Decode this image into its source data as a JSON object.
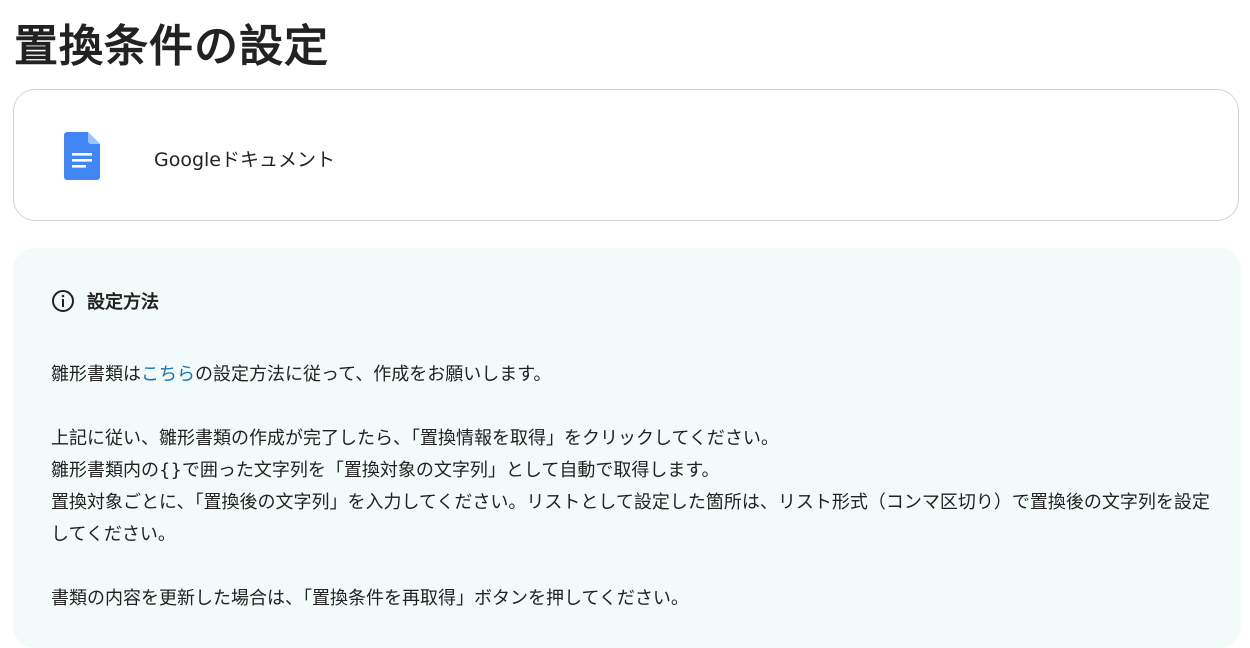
{
  "page": {
    "title": "置換条件の設定"
  },
  "app_card": {
    "app_name": "Googleドキュメント",
    "icon": "google-docs-icon",
    "icon_color": "#4285f4"
  },
  "info": {
    "icon": "info-circle-icon",
    "title": "設定方法",
    "p1_before": "雛形書類は",
    "p1_link": "こちら",
    "p1_after": "の設定方法に従って、作成をお願いします。",
    "p2_line1": "上記に従い、雛形書類の作成が完了したら、「置換情報を取得」をクリックしてください。",
    "p2_line2": "雛形書類内の{}で囲った文字列を「置換対象の文字列」として自動で取得します。",
    "p2_line3": "置換対象ごとに、「置換後の文字列」を入力してください。リストとして設定した箇所は、リスト形式（コンマ区切り）で置換後の文字列を設定してください。",
    "p3": "書類の内容を更新した場合は、「置換条件を再取得」ボタンを押してください。",
    "link_color": "#1a73b8",
    "panel_color": "#f3fafa"
  }
}
